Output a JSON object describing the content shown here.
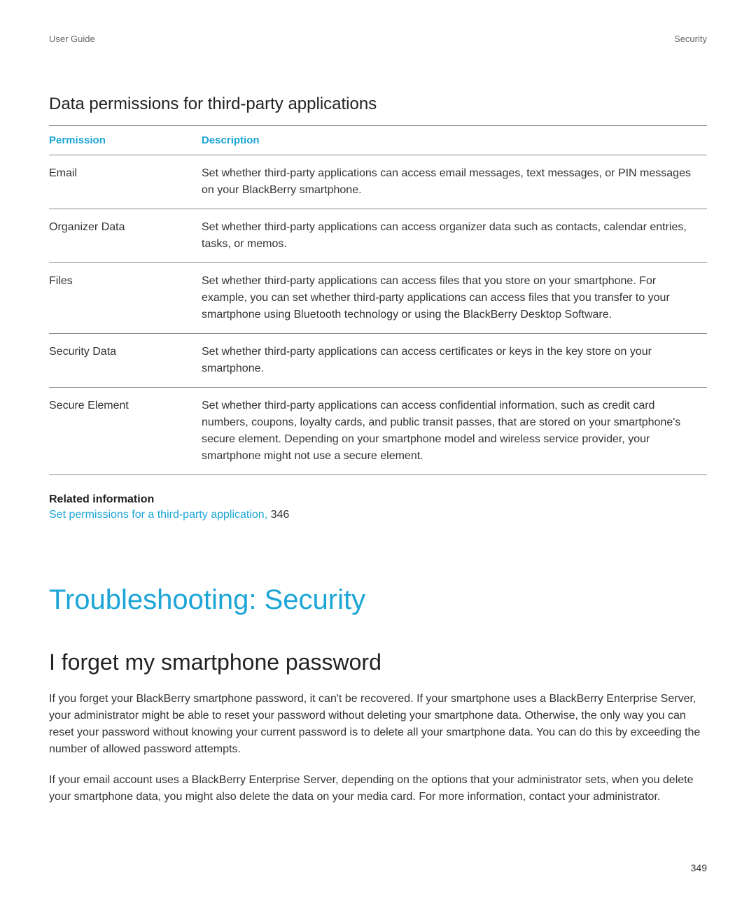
{
  "header": {
    "left": "User Guide",
    "right": "Security"
  },
  "section_title": "Data permissions for third-party applications",
  "table": {
    "headers": {
      "permission": "Permission",
      "description": "Description"
    },
    "rows": [
      {
        "permission": "Email",
        "description": "Set whether third-party applications can access email messages, text messages, or PIN messages on your BlackBerry smartphone."
      },
      {
        "permission": "Organizer Data",
        "description": "Set whether third-party applications can access organizer data such as contacts, calendar entries, tasks, or memos."
      },
      {
        "permission": "Files",
        "description": "Set whether third-party applications can access files that you store on your smartphone. For example, you can set whether third-party applications can access files that you transfer to your smartphone using Bluetooth technology or using the BlackBerry Desktop Software."
      },
      {
        "permission": "Security Data",
        "description": "Set whether third-party applications can access certificates or keys in the key store on your smartphone."
      },
      {
        "permission": "Secure Element",
        "description": "Set whether third-party applications can access confidential information, such as credit card numbers, coupons, loyalty cards, and public transit passes, that are stored on your smartphone's secure element. Depending on your smartphone model and wireless service provider, your smartphone might not use a secure element."
      }
    ]
  },
  "related": {
    "title": "Related information",
    "link_text": "Set permissions for a third-party application,",
    "link_page": " 346"
  },
  "chapter_title": "Troubleshooting: Security",
  "subsection_title": "I forget my smartphone password",
  "paragraphs": {
    "p1": "If you forget your BlackBerry smartphone password, it can't be recovered. If your smartphone uses a BlackBerry Enterprise Server, your administrator might be able to reset your password without deleting your smartphone data. Otherwise, the only way you can reset your password without knowing your current password is to delete all your smartphone data. You can do this by exceeding the number of allowed password attempts.",
    "p2": "If your email account uses a BlackBerry Enterprise Server, depending on the options that your administrator sets, when you delete your smartphone data, you might also delete the data on your media card. For more information, contact your administrator."
  },
  "page_number": "349"
}
